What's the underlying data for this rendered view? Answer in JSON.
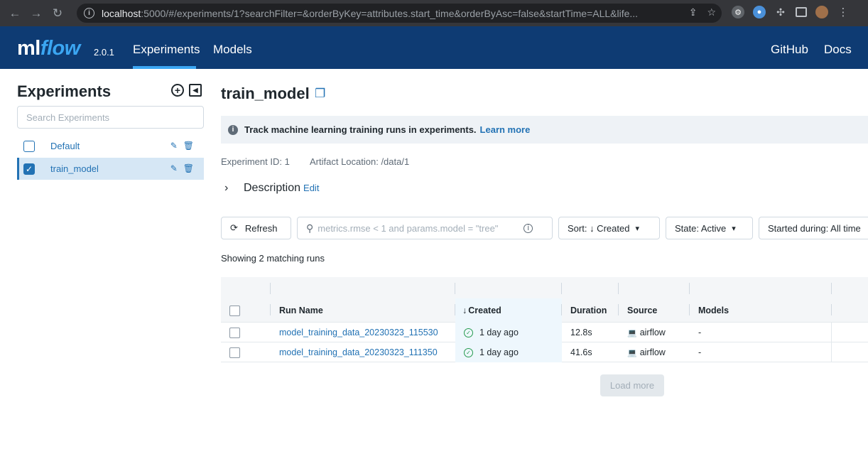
{
  "browser": {
    "url_host": "localhost",
    "url_rest": ":5000/#/experiments/1?searchFilter=&orderByKey=attributes.start_time&orderByAsc=false&startTime=ALL&life..."
  },
  "header": {
    "logo_ml": "ml",
    "logo_flow": "flow",
    "version": "2.0.1",
    "nav": {
      "experiments": "Experiments",
      "models": "Models",
      "github": "GitHub",
      "docs": "Docs"
    }
  },
  "sidebar": {
    "title": "Experiments",
    "search_placeholder": "Search Experiments",
    "items": [
      {
        "label": "Default",
        "checked": false
      },
      {
        "label": "train_model",
        "checked": true
      }
    ]
  },
  "main": {
    "title": "train_model",
    "banner_text": "Track machine learning training runs in experiments.",
    "banner_link": "Learn more",
    "experiment_id": "Experiment ID: 1",
    "artifact_location": "Artifact Location: /data/1",
    "description_label": "Description",
    "description_edit": "Edit",
    "toolbar": {
      "refresh": "Refresh",
      "search_placeholder": "metrics.rmse < 1 and params.model = \"tree\"",
      "sort": "Sort: ↓ Created",
      "state": "State: Active",
      "started": "Started during: All time"
    },
    "count": "Showing 2 matching runs",
    "table": {
      "headers": {
        "run_name": "Run Name",
        "created": "Created",
        "duration": "Duration",
        "source": "Source",
        "models": "Models"
      },
      "rows": [
        {
          "run_name": "model_training_data_20230323_115530",
          "created": "1 day ago",
          "duration": "12.8s",
          "source": "airflow",
          "models": "-"
        },
        {
          "run_name": "model_training_data_20230323_111350",
          "created": "1 day ago",
          "duration": "41.6s",
          "source": "airflow",
          "models": "-"
        }
      ]
    },
    "load_more": "Load more"
  }
}
